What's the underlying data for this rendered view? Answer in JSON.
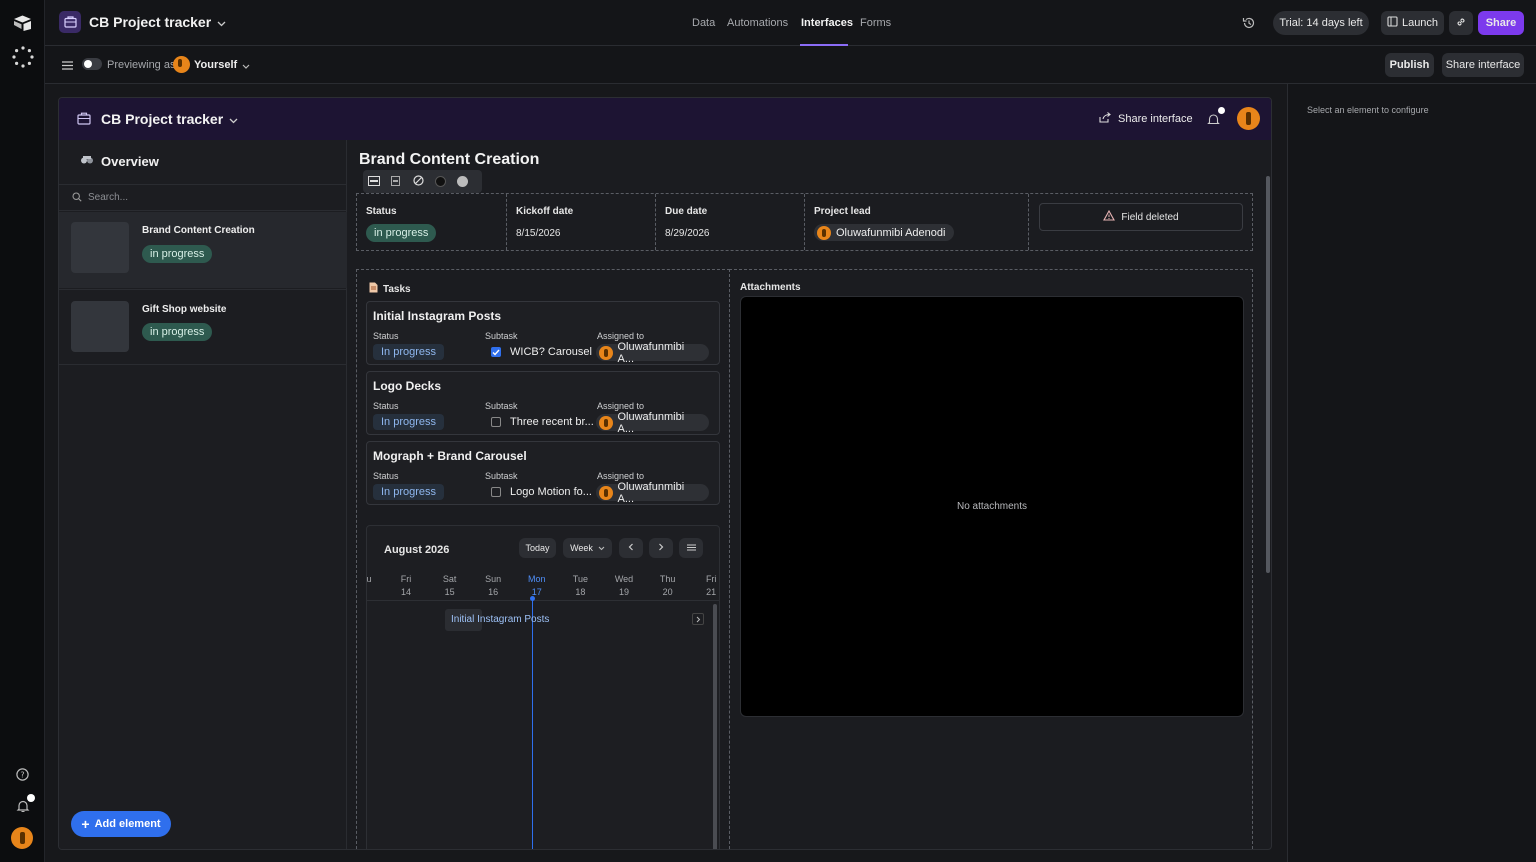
{
  "topbar": {
    "app_title": "CB Project tracker",
    "tabs": [
      "Data",
      "Automations",
      "Interfaces",
      "Forms"
    ],
    "active_tab": "Interfaces",
    "trial": "Trial: 14 days left",
    "launch": "Launch",
    "share": "Share"
  },
  "subbar": {
    "previewing": "Previewing as",
    "user": "Yourself",
    "publish": "Publish",
    "share_interface": "Share interface"
  },
  "app": {
    "title": "CB Project tracker",
    "share_interface": "Share interface"
  },
  "sidebar": {
    "overview": "Overview",
    "search_placeholder": "Search...",
    "items": [
      {
        "title": "Brand Content Creation",
        "status": "in progress"
      },
      {
        "title": "Gift Shop website",
        "status": "in progress"
      }
    ],
    "add_element": "Add element"
  },
  "record": {
    "title": "Brand Content Creation",
    "fields": {
      "status_label": "Status",
      "status": "in progress",
      "kickoff_label": "Kickoff date",
      "kickoff": "8/15/2026",
      "due_label": "Due date",
      "due": "8/29/2026",
      "lead_label": "Project lead",
      "lead": "Oluwafunmibi Adenodi",
      "deleted": "Field deleted"
    }
  },
  "tasks": {
    "header": "Tasks",
    "col_status": "Status",
    "col_subtask": "Subtask",
    "col_assigned": "Assigned to",
    "items": [
      {
        "name": "Initial Instagram Posts",
        "status": "In progress",
        "subtask": "WICB? Carousel",
        "checked": true,
        "assignee": "Oluwafunmibi A..."
      },
      {
        "name": "Logo Decks",
        "status": "In progress",
        "subtask": "Three recent br...",
        "checked": false,
        "assignee": "Oluwafunmibi A..."
      },
      {
        "name": "Mograph + Brand Carousel",
        "status": "In progress",
        "subtask": "Logo Motion fo...",
        "checked": false,
        "assignee": "Oluwafunmibi A..."
      }
    ]
  },
  "calendar": {
    "month": "August 2026",
    "today": "Today",
    "view": "Week",
    "partial_day": "u",
    "days": [
      {
        "d": "Fri",
        "n": "14"
      },
      {
        "d": "Sat",
        "n": "15"
      },
      {
        "d": "Sun",
        "n": "16"
      },
      {
        "d": "Mon",
        "n": "17"
      },
      {
        "d": "Tue",
        "n": "18"
      },
      {
        "d": "Wed",
        "n": "19"
      },
      {
        "d": "Thu",
        "n": "20"
      },
      {
        "d": "Fri",
        "n": "21"
      }
    ],
    "event": "Initial Instagram Posts"
  },
  "attachments": {
    "header": "Attachments",
    "empty": "No attachments"
  },
  "rightpanel": {
    "hint": "Select an element to configure"
  },
  "colors": {
    "accent": "#6d3df5",
    "share": "#7c3aed",
    "status_green": "#2e5a4f",
    "blue": "#2f6fed"
  }
}
